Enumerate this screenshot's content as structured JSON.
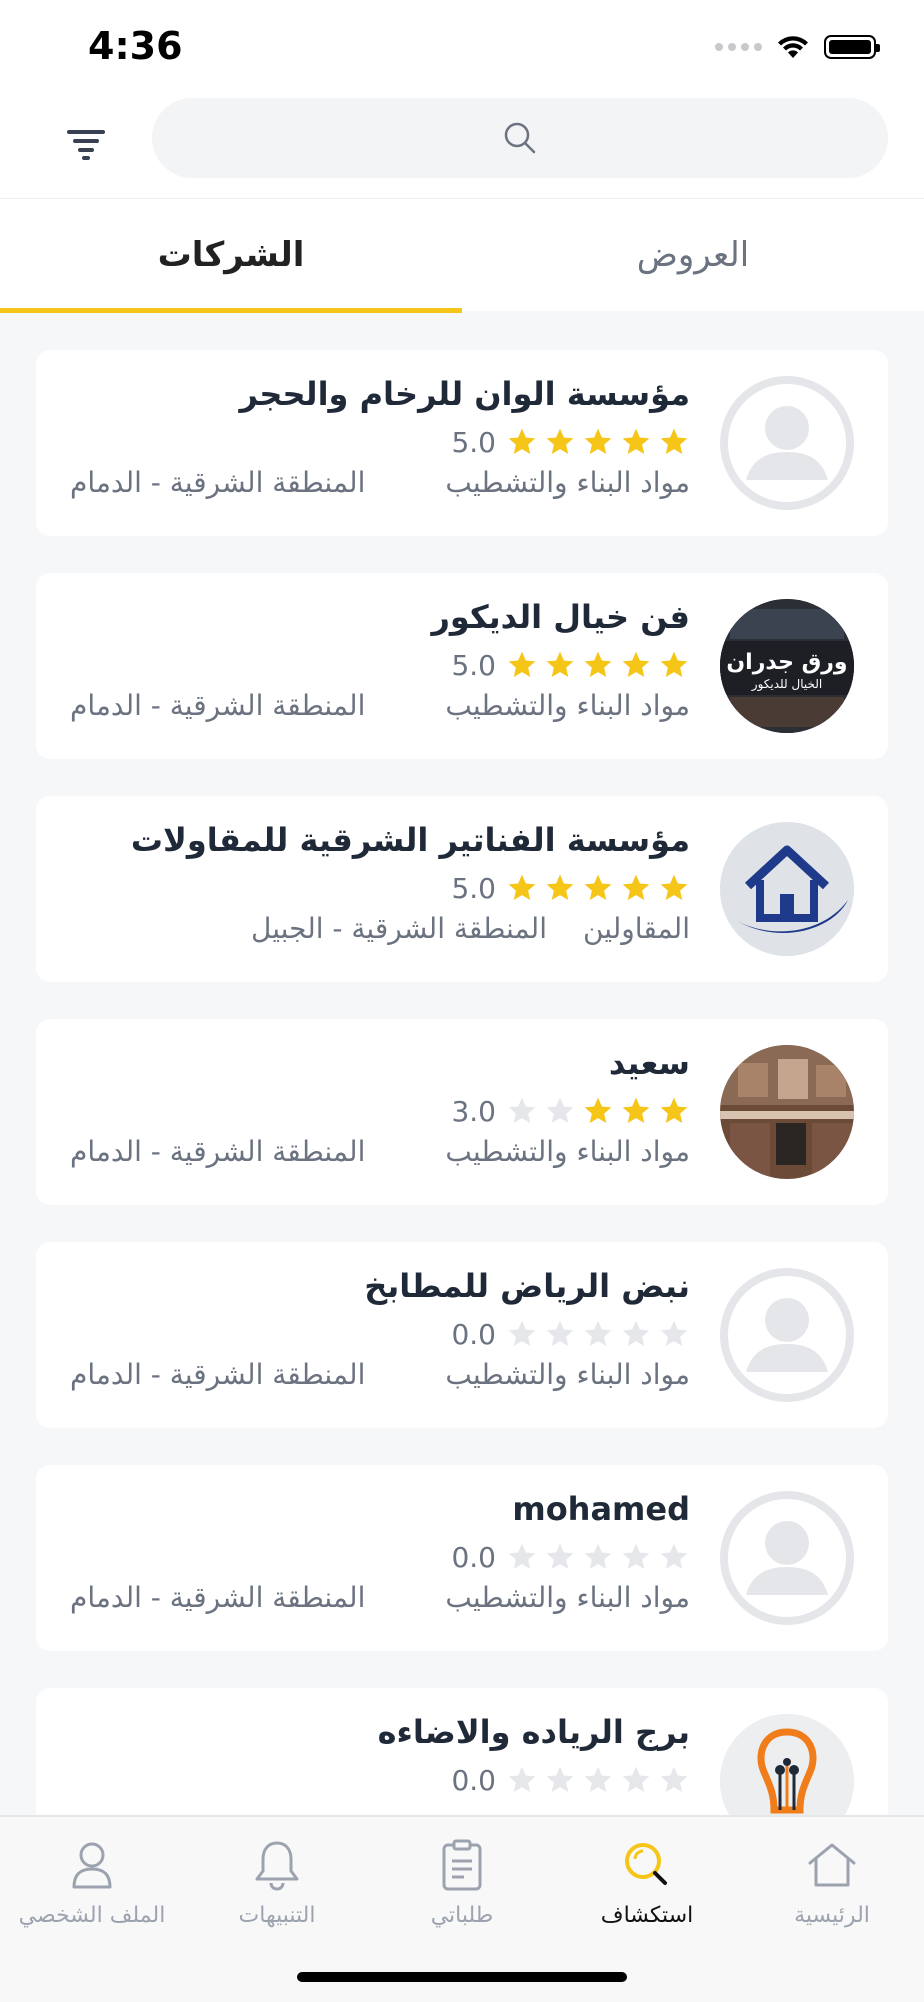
{
  "status_bar": {
    "time": "4:36"
  },
  "search": {
    "placeholder": ""
  },
  "tabs": [
    {
      "label": "الشركات",
      "active": true
    },
    {
      "label": "العروض",
      "active": false
    }
  ],
  "companies": [
    {
      "name": "مؤسسة الوان للرخام والحجر",
      "rating": "5.0",
      "stars": 5,
      "category": "مواد البناء والتشطيب",
      "location": "المنطقة الشرقية - الدمام",
      "avatar": "placeholder"
    },
    {
      "name": "فن خيال الديكور",
      "rating": "5.0",
      "stars": 5,
      "category": "مواد البناء والتشطيب",
      "location": "المنطقة الشرقية - الدمام",
      "avatar": "logo-wallpaper",
      "avatar_text_1": "ورق جدران",
      "avatar_text_2": "الخيال للديكور"
    },
    {
      "name": "مؤسسة الفناتير الشرقية للمقاولات",
      "rating": "5.0",
      "stars": 5,
      "category": "المقاولين",
      "location": "المنطقة الشرقية - الجبيل",
      "avatar": "logo-house"
    },
    {
      "name": "سعيد",
      "rating": "3.0",
      "stars": 3,
      "category": "مواد البناء والتشطيب",
      "location": "المنطقة الشرقية - الدمام",
      "avatar": "photo-kitchen"
    },
    {
      "name": "نبض الرياض للمطابخ",
      "rating": "0.0",
      "stars": 0,
      "category": "مواد البناء والتشطيب",
      "location": "المنطقة الشرقية - الدمام",
      "avatar": "placeholder"
    },
    {
      "name": "mohamed",
      "rating": "0.0",
      "stars": 0,
      "category": "مواد البناء والتشطيب",
      "location": "المنطقة الشرقية - الدمام",
      "avatar": "placeholder"
    },
    {
      "name": "برج الرياده والاضاءه",
      "rating": "0.0",
      "stars": 0,
      "category": "",
      "location": "",
      "avatar": "logo-lightbulb"
    }
  ],
  "bottom_nav": [
    {
      "label": "الرئيسية",
      "icon": "home-icon",
      "active": false
    },
    {
      "label": "استكشاف",
      "icon": "explore-search-icon",
      "active": true
    },
    {
      "label": "طلباتي",
      "icon": "orders-clipboard-icon",
      "active": false
    },
    {
      "label": "التنبيهات",
      "icon": "bell-icon",
      "active": false
    },
    {
      "label": "الملف الشخصي",
      "icon": "profile-icon",
      "active": false
    }
  ],
  "colors": {
    "accent": "#f5c518",
    "star_filled": "#f5c518",
    "star_empty": "#e5e7eb",
    "text_muted": "#6b7280"
  }
}
